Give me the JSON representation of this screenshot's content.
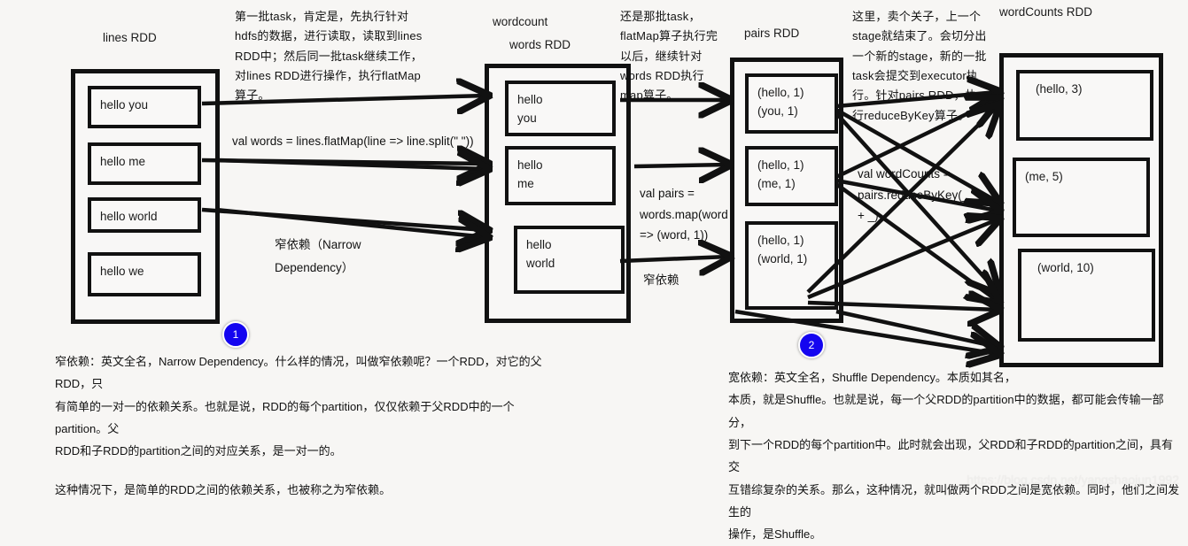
{
  "diagram": {
    "title_labels": {
      "lines_rdd": "lines RDD",
      "wordcount": "wordcount",
      "words_rdd": "words RDD",
      "pairs_rdd": "pairs RDD",
      "word_counts_rdd": "wordCounts RDD"
    },
    "rdds": [
      {
        "id": "lines-rdd",
        "label": "lines RDD",
        "partitions": [
          {
            "lines": [
              "hello you"
            ]
          },
          {
            "lines": [
              "hello me"
            ]
          },
          {
            "lines": [
              "hello world"
            ]
          },
          {
            "lines": [
              "hello we"
            ]
          }
        ]
      },
      {
        "id": "words-rdd",
        "label": "words RDD",
        "partitions": [
          {
            "lines": [
              "hello",
              "you"
            ]
          },
          {
            "lines": [
              "hello",
              "me"
            ]
          },
          {
            "lines": [
              "hello",
              "world"
            ]
          }
        ]
      },
      {
        "id": "pairs-rdd",
        "label": "pairs RDD",
        "partitions": [
          {
            "lines": [
              "(hello, 1)",
              "(you, 1)"
            ]
          },
          {
            "lines": [
              "(hello, 1)",
              "(me, 1)"
            ]
          },
          {
            "lines": [
              "(hello, 1)",
              "(world, 1)"
            ]
          }
        ]
      },
      {
        "id": "word-counts-rdd",
        "label": "wordCounts RDD",
        "partitions": [
          {
            "lines": [
              "(hello, 3)"
            ]
          },
          {
            "lines": [
              "(me, 5)"
            ]
          },
          {
            "lines": [
              "(world, 10)"
            ]
          }
        ]
      }
    ],
    "notes": {
      "note_flatmap": "第一批task，肯定是，先执行针对hdfs的数据，进行读取，读取到lines RDD中；然后同一批task继续工作，对lines RDD进行操作，执行flatMap算子。",
      "note_map": "还是那批task，flatMap算子执行完以后，继续针对words RDD执行map算子。",
      "note_stage": "这里，卖个关子，上一个stage就结束了。会切分出一个新的stage，新的一批task会提交到executor执行。针对pairs RDD，执行reduceByKey算子。"
    },
    "code": {
      "flatmap": "val words = lines.flatMap(line => line.split(\" \"))",
      "map": "val pairs = words.map(word => (word, 1))",
      "reduce_by_key": "val wordCounts = pairs.reduceByKey(_ + _)"
    },
    "dependency_labels": {
      "narrow_inline": "窄依赖（Narrow Dependency）",
      "narrow_short": "窄依赖"
    },
    "badges": [
      {
        "number": "1"
      },
      {
        "number": "2"
      }
    ],
    "paragraphs": {
      "narrow": [
        "窄依赖：英文全名，Narrow Dependency。什么样的情况，叫做窄依赖呢？一个RDD，对它的父RDD，只",
        "有简单的一对一的依赖关系。也就是说，RDD的每个partition，仅仅依赖于父RDD中的一个partition。父",
        "RDD和子RDD的partition之间的对应关系，是一对一的。",
        "这种情况下，是简单的RDD之间的依赖关系，也被称之为窄依赖。"
      ],
      "wide": [
        "宽依赖：英文全名，Shuffle Dependency。本质如其名，",
        "本质，就是Shuffle。也就是说，每一个父RDD的partition中的数据，都可能会传输一部分，",
        "到下一个RDD的每个partition中。此时就会出现，父RDD和子RDD的partition之间，具有交",
        "互错综复杂的关系。那么，这种情况，就叫做两个RDD之间是宽依赖。同时，他们之间发生的",
        "操作，是Shuffle。"
      ]
    },
    "watermark": "https://blog.csdn.net/yangshaojun1992",
    "colors": {
      "badge": "#1405f0",
      "stroke": "#111111",
      "background": "#f7f6f4"
    }
  }
}
